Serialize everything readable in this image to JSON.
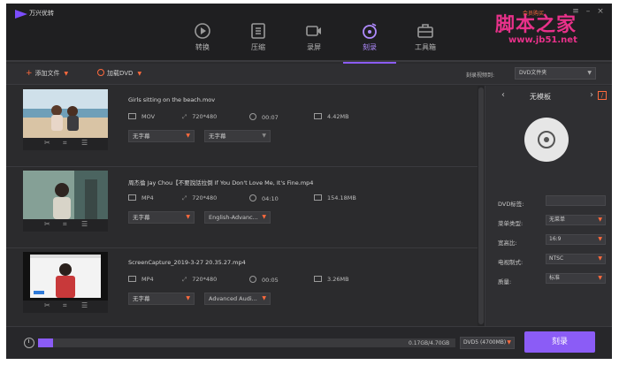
{
  "app": {
    "title": "万兴优转",
    "buy_label": "会员购买",
    "watermark": "脚本之家",
    "watermark_url": "www.jb51.net"
  },
  "nav": [
    {
      "label": "转换",
      "icon": "convert-icon"
    },
    {
      "label": "压缩",
      "icon": "compress-icon"
    },
    {
      "label": "录屏",
      "icon": "record-screen-icon"
    },
    {
      "label": "刻录",
      "icon": "burn-icon",
      "active": true
    },
    {
      "label": "工具箱",
      "icon": "toolbox-icon"
    }
  ],
  "toolbar": {
    "add_file": "添加文件",
    "load_dvd": "加载DVD",
    "burn_to_label": "刻录视频到:",
    "burn_to_value": "DVD文件夹"
  },
  "files": [
    {
      "name": "Girls sitting on the beach.mov",
      "format": "MOV",
      "resolution": "720*480",
      "duration": "00:07",
      "size": "4.42MB",
      "subtitle": "无字幕",
      "audio": "无字幕"
    },
    {
      "name": "周杰倫 Jay Chou【不要說話拉倒 If You Don't Love Me, It's Fine.mp4",
      "format": "MP4",
      "resolution": "720*480",
      "duration": "04:10",
      "size": "154.18MB",
      "subtitle": "无字幕",
      "audio": "English-Advanc..."
    },
    {
      "name": "ScreenCapture_2019-3-27 20.35.27.mp4",
      "format": "MP4",
      "resolution": "720*480",
      "duration": "00:05",
      "size": "3.26MB",
      "subtitle": "无字幕",
      "audio": "Advanced Audi..."
    }
  ],
  "panel": {
    "template_title": "无模板",
    "dvd_label_label": "DVD标签:",
    "dvd_label_value": "",
    "menu_type_label": "菜单类型:",
    "menu_type_value": "无菜单",
    "aspect_label": "宽高比:",
    "aspect_value": "16:9",
    "tv_standard_label": "电视制式:",
    "tv_standard_value": "NTSC",
    "quality_label": "质量:",
    "quality_value": "标准"
  },
  "bottom": {
    "capacity": "0.17GB/4.70GB",
    "progress_fraction": 0.036,
    "disc_size": "DVD5 (4700MB)",
    "burn_button": "刻录"
  },
  "colors": {
    "accent": "#8b5cf6",
    "orange": "#ff6a3d",
    "background": "#2b2b2d"
  }
}
